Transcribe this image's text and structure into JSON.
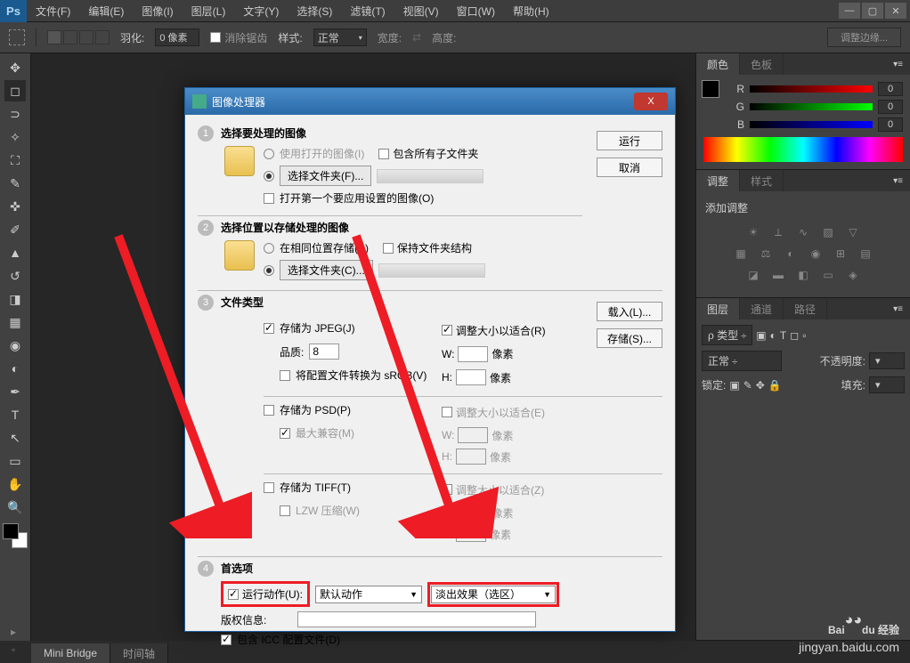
{
  "menubar": {
    "logo": "Ps",
    "items": [
      "文件(F)",
      "编辑(E)",
      "图像(I)",
      "图层(L)",
      "文字(Y)",
      "选择(S)",
      "滤镜(T)",
      "视图(V)",
      "窗口(W)",
      "帮助(H)"
    ]
  },
  "optionsbar": {
    "feather_label": "羽化:",
    "feather_value": "0 像素",
    "antialias": "消除锯齿",
    "style_label": "样式:",
    "style_value": "正常",
    "width_label": "宽度:",
    "height_label": "高度:",
    "refine_edge": "调整边缘..."
  },
  "panels": {
    "color_tab": "颜色",
    "swatches_tab": "色板",
    "r_label": "R",
    "r_val": "0",
    "g_label": "G",
    "g_val": "0",
    "b_label": "B",
    "b_val": "0",
    "adjustments_tab": "调整",
    "styles_tab": "样式",
    "add_adjustment": "添加调整",
    "layers_tab": "图层",
    "channels_tab": "通道",
    "paths_tab": "路径",
    "kind_label": "类型",
    "blend_mode": "正常",
    "opacity_label": "不透明度:",
    "lock_label": "锁定:",
    "fill_label": "填充:"
  },
  "bottom_tabs": {
    "mini_bridge": "Mini Bridge",
    "timeline": "时间轴"
  },
  "dialog": {
    "title": "图像处理器",
    "run": "运行",
    "cancel": "取消",
    "load": "载入(L)...",
    "save": "存储(S)...",
    "step1": {
      "num": "1",
      "title": "选择要处理的图像",
      "use_open": "使用打开的图像(I)",
      "include_sub": "包含所有子文件夹",
      "select_folder": "选择文件夹(F)...",
      "open_first": "打开第一个要应用设置的图像(O)"
    },
    "step2": {
      "num": "2",
      "title": "选择位置以存储处理的图像",
      "same_loc": "在相同位置存储(A)",
      "keep_struct": "保持文件夹结构",
      "select_folder": "选择文件夹(C)..."
    },
    "step3": {
      "num": "3",
      "title": "文件类型",
      "jpeg_save": "存储为 JPEG(J)",
      "jpeg_quality_label": "品质:",
      "jpeg_quality_value": "8",
      "jpeg_srgb": "将配置文件转换为 sRGB(V)",
      "jpeg_resize": "调整大小以适合(R)",
      "psd_save": "存储为 PSD(P)",
      "psd_compat": "最大兼容(M)",
      "psd_resize": "调整大小以适合(E)",
      "tiff_save": "存储为 TIFF(T)",
      "tiff_lzw": "LZW 压缩(W)",
      "tiff_resize": "调整大小以适合(Z)",
      "w_label": "W:",
      "h_label": "H:",
      "px": "像素"
    },
    "step4": {
      "num": "4",
      "title": "首选项",
      "run_action": "运行动作(U):",
      "action_set": "默认动作",
      "action": "淡出效果（选区）",
      "copyright_label": "版权信息:",
      "include_icc": "包含 ICC 配置文件(D)"
    }
  },
  "watermark": {
    "brand": "Baidu 经验",
    "url": "jingyan.baidu.com"
  }
}
